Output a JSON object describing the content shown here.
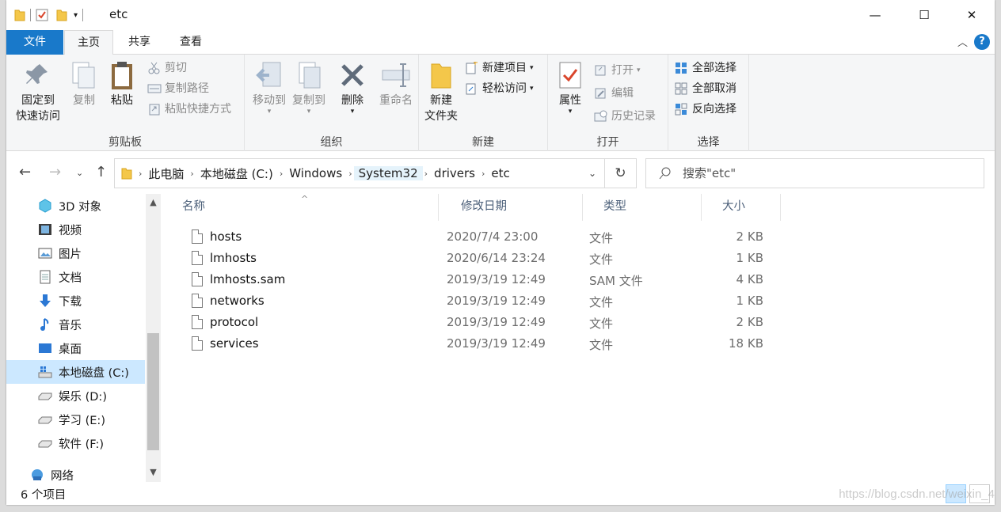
{
  "window": {
    "title": "etc",
    "minimize": "—",
    "maximize": "☐",
    "close": "✕"
  },
  "tabs": {
    "file": "文件",
    "home": "主页",
    "share": "共享",
    "view": "查看",
    "help": "?"
  },
  "ribbon": {
    "clipboard": {
      "label": "剪贴板",
      "pin_line1": "固定到",
      "pin_line2": "快速访问",
      "copy": "复制",
      "paste": "粘贴",
      "cut": "剪切",
      "copy_path": "复制路径",
      "paste_shortcut": "粘贴快捷方式"
    },
    "organize": {
      "label": "组织",
      "move_to": "移动到",
      "copy_to": "复制到",
      "delete": "删除",
      "rename": "重命名"
    },
    "new": {
      "label": "新建",
      "new_folder_line1": "新建",
      "new_folder_line2": "文件夹",
      "new_item": "新建项目",
      "easy_access": "轻松访问"
    },
    "open": {
      "label": "打开",
      "properties": "属性",
      "open": "打开",
      "edit": "编辑",
      "history": "历史记录"
    },
    "select": {
      "label": "选择",
      "select_all": "全部选择",
      "select_none": "全部取消",
      "invert": "反向选择"
    }
  },
  "address": {
    "crumbs": [
      "此电脑",
      "本地磁盘 (C:)",
      "Windows",
      "System32",
      "drivers",
      "etc"
    ],
    "search_placeholder": "搜索\"etc\""
  },
  "navpane": {
    "items": [
      {
        "label": "3D 对象",
        "icon": "3d-objects-icon"
      },
      {
        "label": "视频",
        "icon": "video-icon"
      },
      {
        "label": "图片",
        "icon": "pictures-icon"
      },
      {
        "label": "文档",
        "icon": "documents-icon"
      },
      {
        "label": "下载",
        "icon": "download-icon"
      },
      {
        "label": "音乐",
        "icon": "music-icon"
      },
      {
        "label": "桌面",
        "icon": "desktop-icon"
      },
      {
        "label": "本地磁盘 (C:)",
        "icon": "drive-c-icon"
      },
      {
        "label": "娱乐 (D:)",
        "icon": "drive-icon"
      },
      {
        "label": "学习 (E:)",
        "icon": "drive-icon"
      },
      {
        "label": "软件 (F:)",
        "icon": "drive-icon"
      },
      {
        "label": "网络",
        "icon": "network-icon"
      }
    ]
  },
  "filelist": {
    "columns": {
      "name": "名称",
      "date": "修改日期",
      "type": "类型",
      "size": "大小"
    },
    "rows": [
      {
        "name": "hosts",
        "date": "2020/7/4 23:00",
        "type": "文件",
        "size": "2 KB"
      },
      {
        "name": "lmhosts",
        "date": "2020/6/14 23:24",
        "type": "文件",
        "size": "1 KB"
      },
      {
        "name": "lmhosts.sam",
        "date": "2019/3/19 12:49",
        "type": "SAM 文件",
        "size": "4 KB"
      },
      {
        "name": "networks",
        "date": "2019/3/19 12:49",
        "type": "文件",
        "size": "1 KB"
      },
      {
        "name": "protocol",
        "date": "2019/3/19 12:49",
        "type": "文件",
        "size": "2 KB"
      },
      {
        "name": "services",
        "date": "2019/3/19 12:49",
        "type": "文件",
        "size": "18 KB"
      }
    ]
  },
  "status": {
    "count": "6 个项目"
  },
  "watermark": "https://blog.csdn.net/weixin_4",
  "colors": {
    "accent": "#1979ca",
    "selected": "#cce8ff"
  }
}
